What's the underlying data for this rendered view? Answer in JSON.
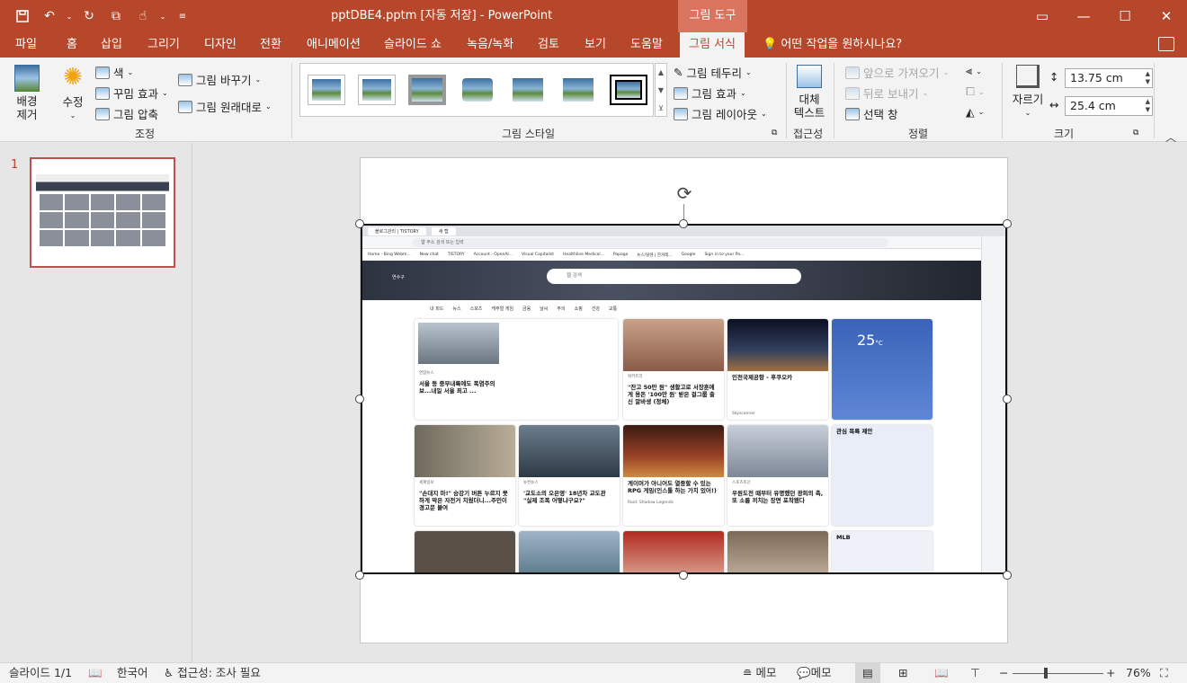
{
  "window": {
    "doc_title": "pptDBE4.pptm [자동 저장]  -  PowerPoint",
    "context_header": "그림 도구",
    "buttons": {
      "restore": "▭",
      "minimize": "—",
      "maximize": "☐",
      "close": "✕"
    }
  },
  "tabs": [
    "파일",
    "홈",
    "삽입",
    "그리기",
    "디자인",
    "전환",
    "애니메이션",
    "슬라이드 쇼",
    "녹음/녹화",
    "검토",
    "보기",
    "도움말",
    "그림 서식"
  ],
  "tell_me": "어떤 작업을 원하시나요?",
  "ribbon": {
    "adjust": {
      "remove_bg": [
        "배경",
        "제거"
      ],
      "corrections": "수정",
      "color": "색",
      "artistic": "꾸밈 효과",
      "compress": "그림 압축",
      "change": "그림 바꾸기",
      "reset": "그림 원래대로",
      "label": "조정"
    },
    "styles": {
      "border": "그림 테두리",
      "effects": "그림 효과",
      "layout": "그림 레이아웃",
      "label": "그림 스타일"
    },
    "accessibility": {
      "alt_text": [
        "대체",
        "텍스트"
      ],
      "label": "접근성"
    },
    "arrange": {
      "bring_forward": "앞으로 가져오기",
      "send_backward": "뒤로 보내기",
      "selection_pane": "선택 창",
      "label": "정렬"
    },
    "size": {
      "crop": "자르기",
      "height": "13.75 cm",
      "width": "25.4 cm",
      "label": "크기"
    }
  },
  "slides_pane": {
    "slide_number": "1"
  },
  "embedded_browser": {
    "tab1": "블로그관리 | TISTORY",
    "tab2": "새 탭",
    "address_placeholder": "웹 주소 검색 또는 입력",
    "bookmarks": [
      "Home - Bing Webm...",
      "New chat",
      "TISTORY",
      "Account - OpenAI...",
      "Visual Capitalist",
      "Healthline Medical...",
      "Papago",
      "뉴스/탈렌 | 한겨레...",
      "Google",
      "Sign in to your Pa..."
    ],
    "location": "연수구",
    "search_placeholder": "웹 검색",
    "nav": [
      "내 피드",
      "뉴스",
      "스포츠",
      "캐주얼 게임",
      "금융",
      "날씨",
      "주의",
      "쇼핑",
      "건강",
      "교통"
    ],
    "cards": [
      {
        "source": "연합뉴스",
        "title": "서울 등 중부내륙에도 폭염주의보...내일 서울 최고 ..."
      },
      {
        "source": "위키트리",
        "title": "\"잔고 50만 원\" 생활고로 서장훈에게 용돈 '100만 원' 받은 걸그룹 출신 알바생 (정체)"
      },
      {
        "source": "Skyscanner",
        "title": "인천국제공항 - 후쿠오카"
      },
      {
        "source": "세계일보",
        "title": "\"손대지 마!\" 승강기 버튼 누르지 못하게 막은 자전거 치웠더니...주민이 경고문 붙여"
      },
      {
        "source": "뉴컨뉴스",
        "title": "'교도소의 오은영' 18년차 교도관 \"실제 조폭 어떻냐구요?\""
      },
      {
        "source": "Raid: Shadow Legends",
        "title": "게이머가 아니어도 열중할 수 있는 RPG 게임(인스톨 하는 가치 있어!)"
      },
      {
        "source": "스포츠조선",
        "title": "우원도전 때부터 유명했던 광희의 촉, 또 소름 끼치는 장면 포착됐다"
      }
    ],
    "weather": {
      "temp": "25",
      "unit": "°C"
    },
    "stocks_title": "관심 목록 제안",
    "mlb": "MLB"
  },
  "status": {
    "slide": "슬라이드 1/1",
    "language": "한국어",
    "accessibility": "접근성: 조사 필요",
    "notes": "메모",
    "comments": "메모",
    "zoom": "76%"
  }
}
